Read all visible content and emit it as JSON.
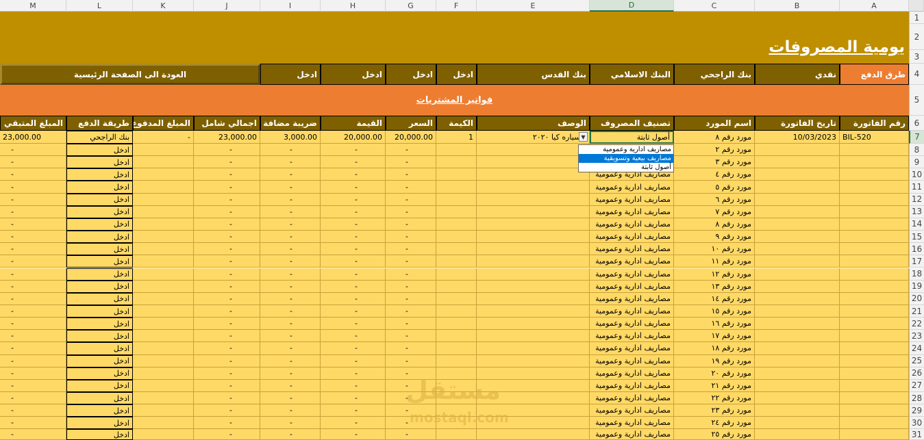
{
  "columns": [
    "M",
    "L",
    "K",
    "J",
    "I",
    "H",
    "G",
    "F",
    "E",
    "D",
    "C",
    "B",
    "A"
  ],
  "title": "يومية المصروفات",
  "payment": {
    "label": "طرق الدفع",
    "methods": [
      "نقدي",
      "بنك الراجحي",
      "البنك الاسلامي",
      "بنك القدس",
      "ادخل",
      "ادخل",
      "ادخل",
      "ادخل"
    ],
    "back_button": "العودة الى الصفحة الرئيسية"
  },
  "section_title": "فواتير المشتريات",
  "headers": [
    "رقم الفاتورة",
    "تاريخ الفاتورة",
    "اسم المورد",
    "تصنيف المصروف",
    "الوصف",
    "الكيمة",
    "السعر",
    "القيمة",
    "ضريبة مضافة",
    "اجمالي شامل",
    "المبلغ المدفوع",
    "طريقة الدفع",
    "المبلغ المتبقي"
  ],
  "first_row": {
    "invoice_no": "BIL-520",
    "date": "10/03/2023",
    "supplier": "مورد رقم ٨",
    "category": "أصول ثابتة",
    "description": "ء سياره كيا ٢٠٢٠",
    "quantity": "1",
    "price": "20,000.00",
    "value": "20,000.00",
    "vat": "3,000.00",
    "total": "23,000.00",
    "paid": "-",
    "method": "بنك الراجحي",
    "remaining": "23,000.00"
  },
  "rows": [
    {
      "supplier": "مورد رقم ٢"
    },
    {
      "supplier": "مورد رقم ٣"
    },
    {
      "supplier": "مورد رقم ٤"
    },
    {
      "supplier": "مورد رقم ٥"
    },
    {
      "supplier": "مورد رقم ٦"
    },
    {
      "supplier": "مورد رقم ٧"
    },
    {
      "supplier": "مورد رقم ٨"
    },
    {
      "supplier": "مورد رقم ٩"
    },
    {
      "supplier": "مورد رقم ١٠"
    },
    {
      "supplier": "مورد رقم ١١"
    },
    {
      "supplier": "مورد رقم ١٢"
    },
    {
      "supplier": "مورد رقم ١٣"
    },
    {
      "supplier": "مورد رقم ١٤"
    },
    {
      "supplier": "مورد رقم ١٥"
    },
    {
      "supplier": "مورد رقم ١٦"
    },
    {
      "supplier": "مورد رقم ١٧"
    },
    {
      "supplier": "مورد رقم ١٨"
    },
    {
      "supplier": "مورد رقم ١٩"
    },
    {
      "supplier": "مورد رقم ٢٠"
    },
    {
      "supplier": "مورد رقم ٢١"
    },
    {
      "supplier": "مورد رقم ٢٢"
    },
    {
      "supplier": "مورد رقم ٢٣"
    },
    {
      "supplier": "مورد رقم ٢٤"
    },
    {
      "supplier": "مورد رقم ٢٥"
    }
  ],
  "default_row": {
    "category": "مصاريف ادارية وعمومية",
    "dash": "-",
    "method": "ادخل"
  },
  "row_numbers": [
    "1",
    "2",
    "3",
    "4",
    "5",
    "6",
    "7",
    "8",
    "9",
    "10",
    "11",
    "12",
    "13",
    "14",
    "15",
    "16",
    "17",
    "18",
    "19",
    "20",
    "21",
    "22",
    "23",
    "24",
    "25",
    "26",
    "27",
    "28",
    "29",
    "30",
    "31"
  ],
  "dropdown": {
    "options": [
      "مصاريف ادارية وعمومية",
      "مصاريف بيعية وتسويقية",
      "أصول ثابتة"
    ],
    "highlighted_index": 1
  },
  "watermark": {
    "arabic": "مستقل",
    "latin": "mostaql.com"
  },
  "colors": {
    "gold": "#bf8f00",
    "orange": "#ed7d31",
    "dark": "#7f6000",
    "row": "#ffd966"
  }
}
